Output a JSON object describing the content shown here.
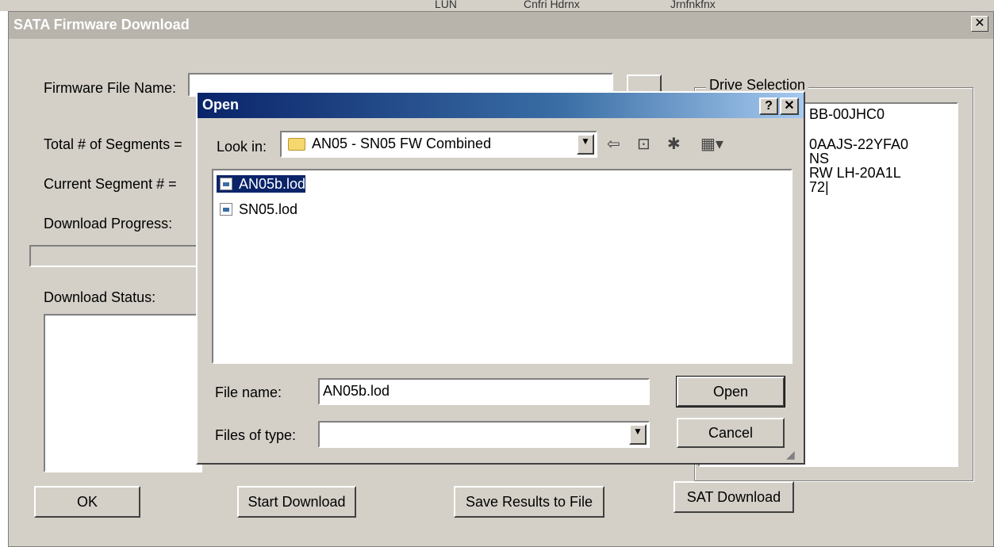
{
  "background_strip": {
    "items": [
      "LUN",
      "Cnfri Hdrnx",
      "Jrnfnkfnx"
    ]
  },
  "main_window": {
    "title": "SATA Firmware Download",
    "close_glyph": "✕",
    "labels": {
      "firmware_file": "Firmware File Name:",
      "total_segments": "Total # of Segments =",
      "current_segment": "Current Segment # =",
      "download_progress": "Download Progress:",
      "download_status": "Download Status:"
    },
    "firmware_file_value": "",
    "drive_selection": {
      "title": "Drive Selection",
      "items": [
        "BB-00JHC0",
        "",
        "0AAJS-22YFA0",
        "NS",
        "RW LH-20A1L",
        "72|"
      ]
    },
    "buttons": {
      "ok": "OK",
      "start_download": "Start Download",
      "save_results": "Save Results to File",
      "sat_download": "SAT Download"
    }
  },
  "open_dialog": {
    "title": "Open",
    "help_glyph": "?",
    "close_glyph": "✕",
    "look_in_label": "Look in:",
    "look_in_value": "AN05 - SN05 FW Combined",
    "files": [
      {
        "name": "AN05b.lod",
        "selected": true
      },
      {
        "name": "SN05.lod",
        "selected": false
      }
    ],
    "file_name_label": "File name:",
    "file_name_value": "AN05b.lod",
    "files_of_type_label": "Files of type:",
    "files_of_type_value": "",
    "open_button": "Open",
    "cancel_button": "Cancel",
    "toolbar_icons": [
      "back-arrow-icon",
      "up-folder-icon",
      "new-folder-icon",
      "view-menu-icon"
    ]
  }
}
